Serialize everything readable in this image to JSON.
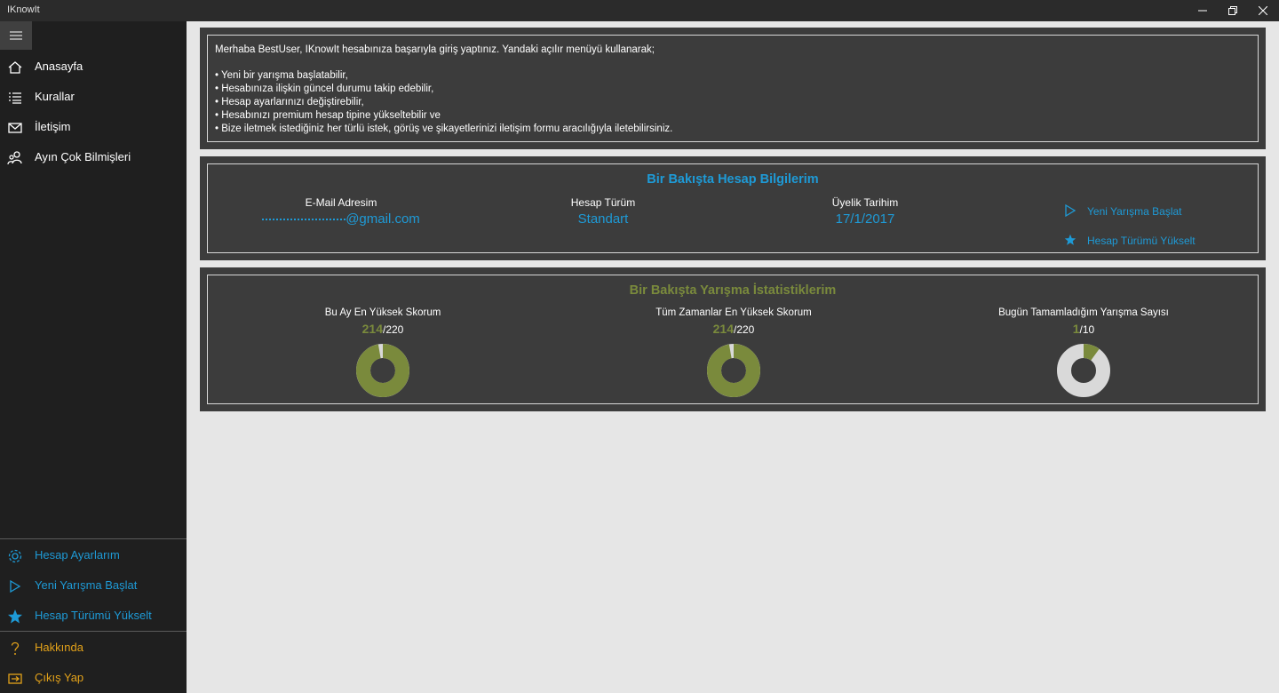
{
  "app": {
    "title": "IKnowIt"
  },
  "nav": {
    "top": [
      {
        "label": "Anasayfa",
        "icon": "home-icon"
      },
      {
        "label": "Kurallar",
        "icon": "list-icon"
      },
      {
        "label": "İletişim",
        "icon": "mail-icon"
      },
      {
        "label": "Ayın Çok Bilmişleri",
        "icon": "people-icon"
      }
    ],
    "bottom": [
      {
        "label": "Hesap Ayarlarım",
        "icon": "gear-icon"
      },
      {
        "label": "Yeni Yarışma Başlat",
        "icon": "play-icon"
      },
      {
        "label": "Hesap Türümü Yükselt",
        "icon": "star-icon"
      }
    ],
    "footer": [
      {
        "label": "Hakkında",
        "icon": "question-icon"
      },
      {
        "label": "Çıkış Yap",
        "icon": "exit-icon"
      }
    ]
  },
  "welcome": {
    "intro": "Merhaba BestUser, IKnowIt hesabınıza başarıyla giriş yaptınız. Yandaki açılır menüyü kullanarak;",
    "bullets": [
      "• Yeni bir yarışma başlatabilir,",
      "• Hesabınıza ilişkin güncel durumu takip edebilir,",
      "• Hesap ayarlarınızı değiştirebilir,",
      "• Hesabınızı premium hesap tipine yükseltebilir ve",
      "• Bize iletmek istediğiniz her türlü istek, görüş ve şikayetlerinizi iletişim formu aracılığıyla iletebilirsiniz."
    ]
  },
  "account": {
    "title": "Bir Bakışta Hesap Bilgilerim",
    "email_label": "E-Mail Adresim",
    "email_value": "@gmail.com",
    "type_label": "Hesap Türüm",
    "type_value": "Standart",
    "date_label": "Üyelik Tarihim",
    "date_value": "17/1/2017",
    "action_new": "Yeni Yarışma Başlat",
    "action_upgrade": "Hesap Türümü Yükselt"
  },
  "stats": {
    "title": "Bir Bakışta Yarışma İstatistiklerim",
    "items": [
      {
        "label": "Bu Ay En Yüksek Skorum",
        "value": "214",
        "max": "/220",
        "fraction": 0.9727
      },
      {
        "label": "Tüm Zamanlar En Yüksek Skorum",
        "value": "214",
        "max": "/220",
        "fraction": 0.9727
      },
      {
        "label": "Bugün Tamamladığım Yarışma Sayısı",
        "value": "1",
        "max": "/10",
        "fraction": 0.1
      }
    ]
  },
  "colors": {
    "accent": "#1e9ad6",
    "olive": "#7a8a3c",
    "orange": "#e3a21a",
    "track": "#d9d9d9"
  }
}
